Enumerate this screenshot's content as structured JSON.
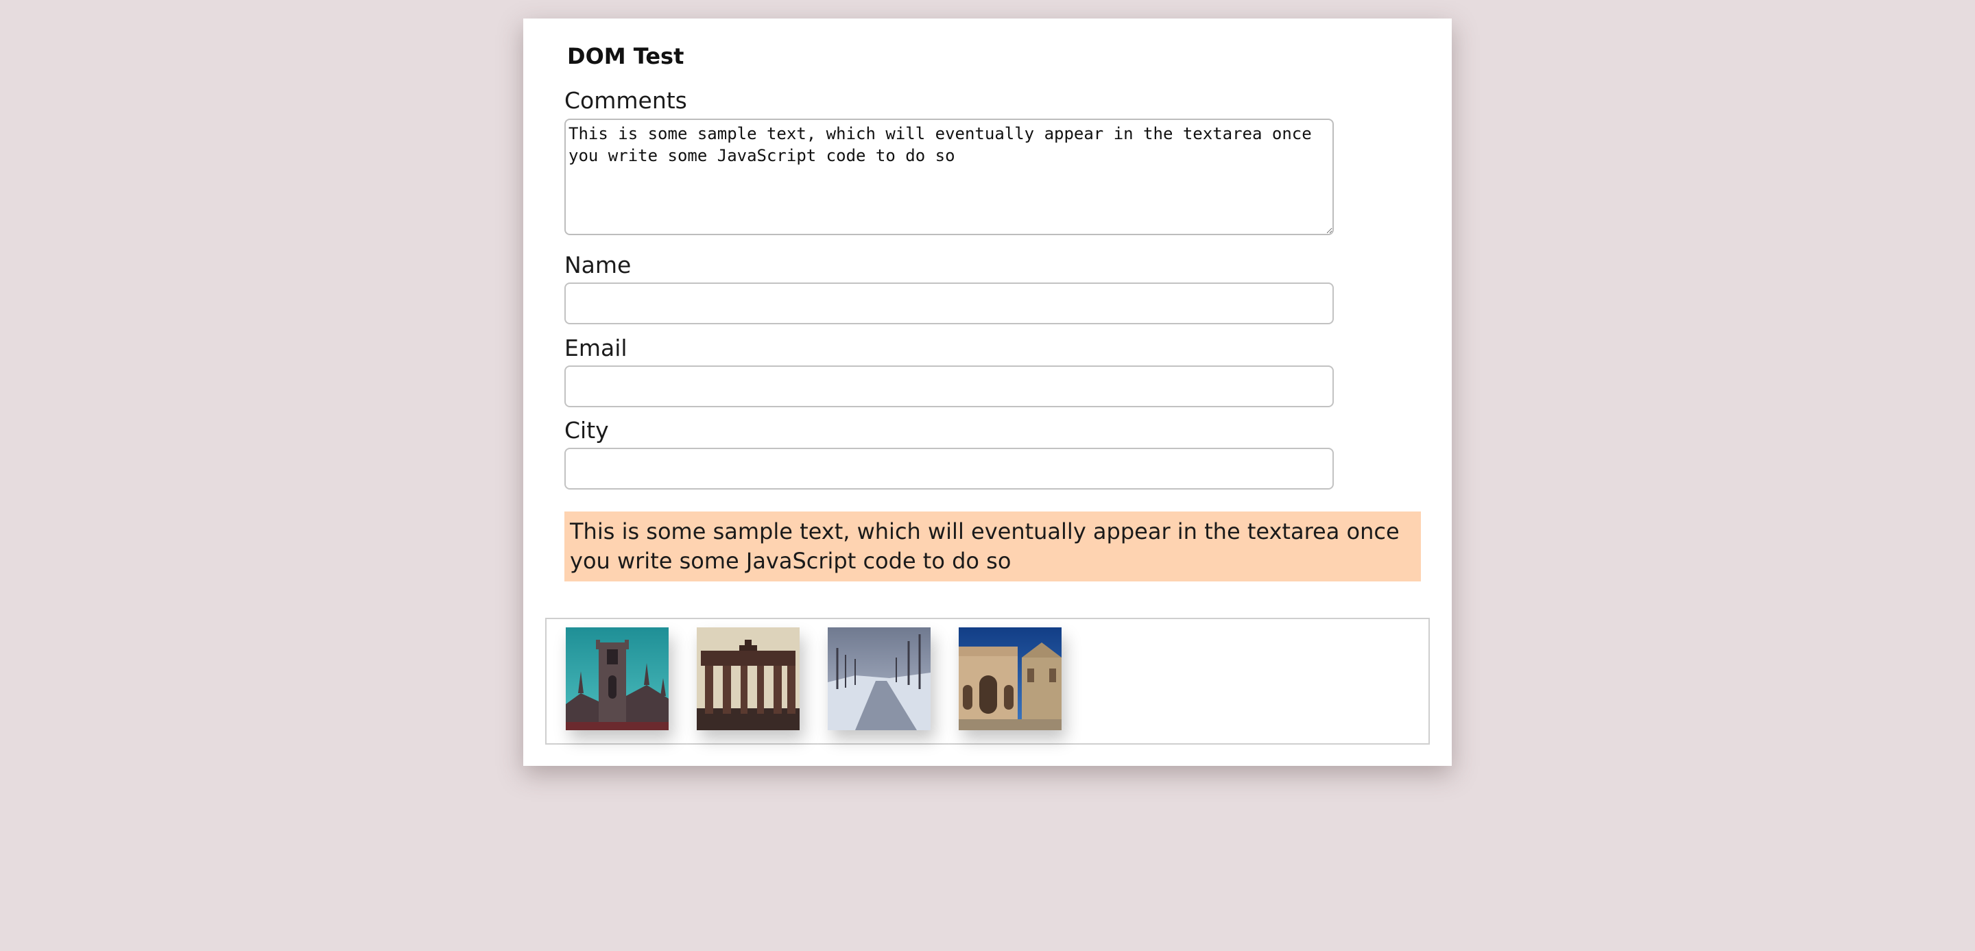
{
  "page": {
    "title": "DOM Test"
  },
  "form": {
    "comments_label": "Comments",
    "comments_value": "This is some sample text, which will eventually appear in the textarea once you write some JavaScript code to do so",
    "name_label": "Name",
    "name_value": "",
    "email_label": "Email",
    "email_value": "",
    "city_label": "City",
    "city_value": ""
  },
  "output": {
    "text": "This is some sample text, which will eventually appear in the textarea once you write some JavaScript code to do so",
    "background": "#fed3b1"
  },
  "gallery": {
    "images": [
      {
        "subject": "gothic-church",
        "sky": "#2e9c9e"
      },
      {
        "subject": "brandenburg-gate",
        "sky": "#d8ccb2"
      },
      {
        "subject": "snowy-road",
        "sky": "#9aa2b8"
      },
      {
        "subject": "roman-arch",
        "sky": "#1d4f9a"
      }
    ]
  },
  "colors": {
    "page_background": "#e6dcde",
    "card_background": "#ffffff",
    "input_border": "#c2c2c2"
  }
}
